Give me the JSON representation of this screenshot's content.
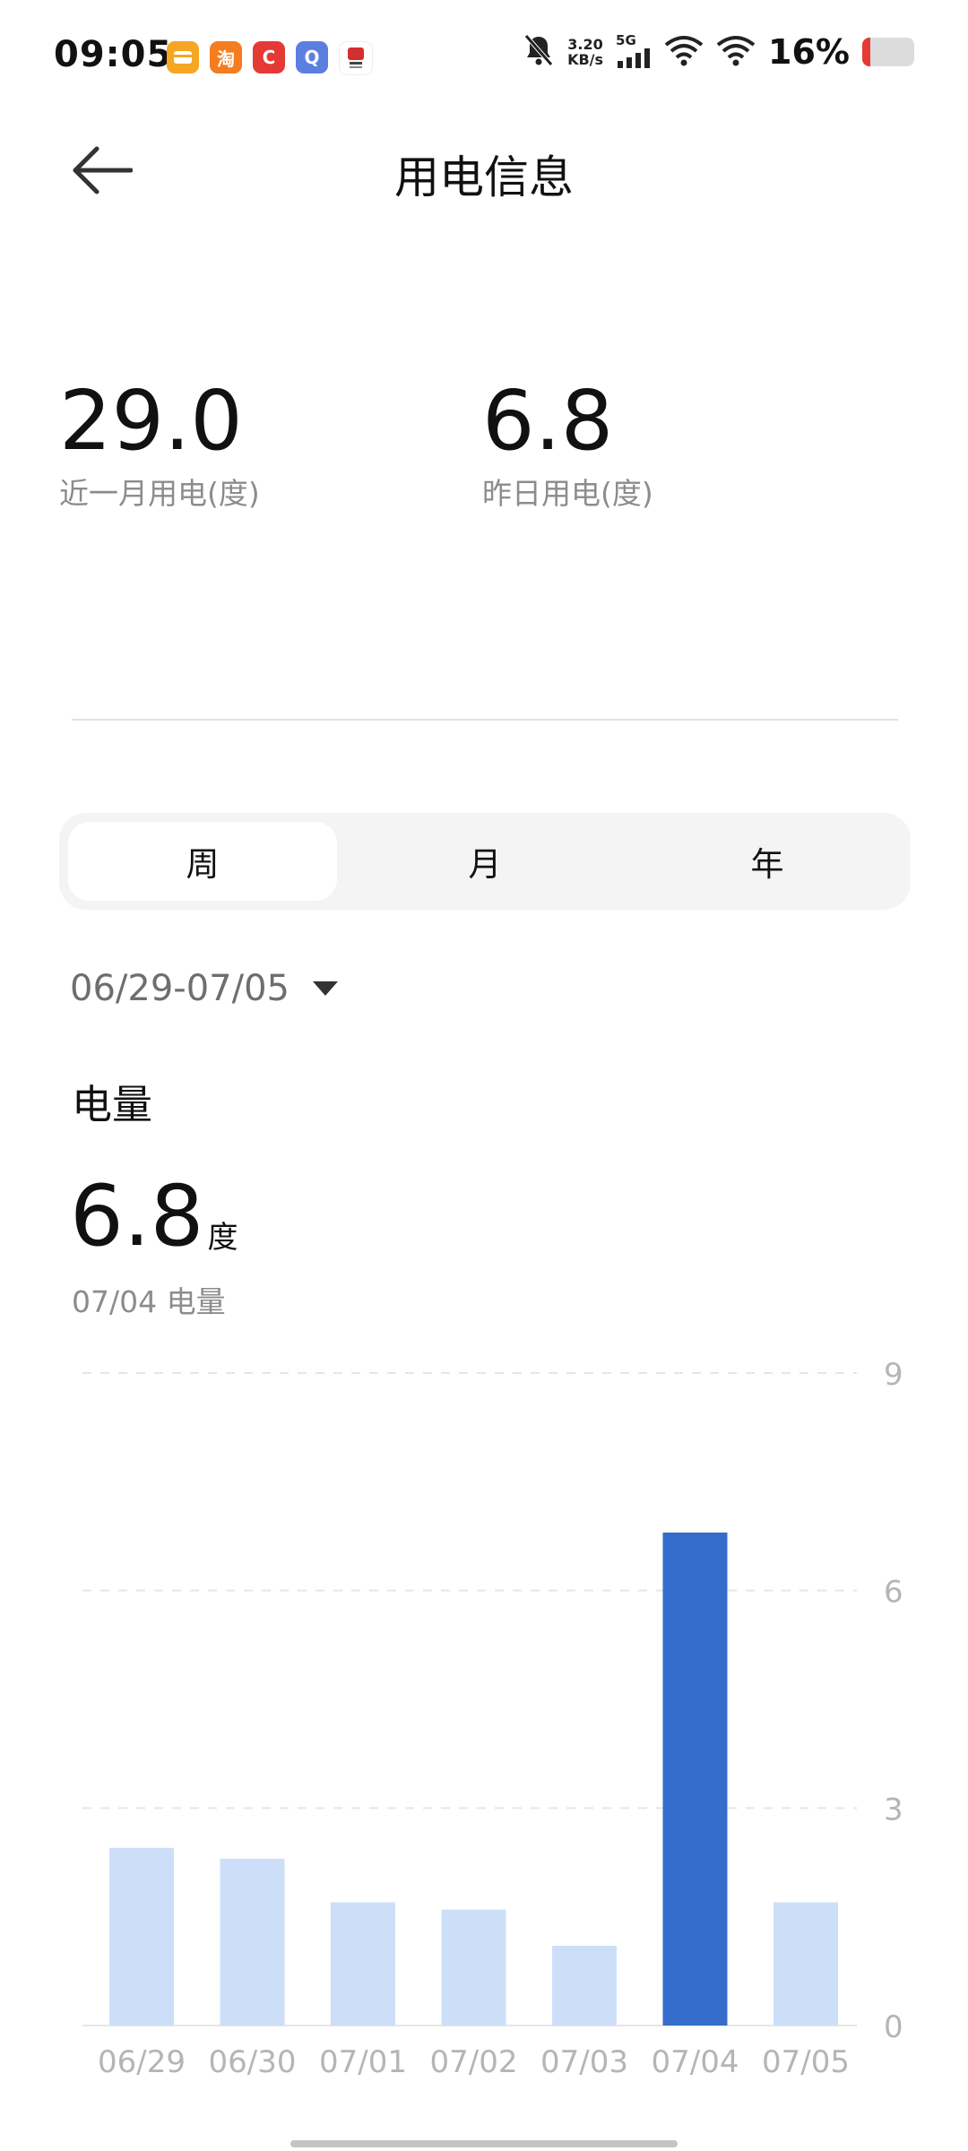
{
  "status_bar": {
    "time": "09:05",
    "net_speed_value": "3.20",
    "net_speed_unit": "KB/s",
    "signal_type": "5G",
    "battery_percent": "16%",
    "battery_level": 0.16,
    "app_icons": [
      "wallet-app-icon",
      "taobao-app-icon",
      "c-app-icon",
      "q-app-icon",
      "kfc-app-icon"
    ],
    "app_icon_text": {
      "taobao": "淘",
      "c": "C",
      "q": "Q"
    }
  },
  "header": {
    "title": "用电信息"
  },
  "summary": {
    "month_value": "29.0",
    "month_label": "近一月用电(度)",
    "yesterday_value": "6.8",
    "yesterday_label": "昨日用电(度)"
  },
  "tabs": [
    {
      "label": "周",
      "active": true
    },
    {
      "label": "月",
      "active": false
    },
    {
      "label": "年",
      "active": false
    }
  ],
  "date_range": "06/29-07/05",
  "section": {
    "title": "电量",
    "value": "6.8",
    "unit": "度",
    "caption": "07/04 电量"
  },
  "colors": {
    "bar_default": "#cddff8",
    "bar_selected": "#356bcb",
    "grid": "#e6e6e6",
    "axis_text": "#b5b5b5"
  },
  "chart_data": {
    "type": "bar",
    "categories": [
      "06/29",
      "06/30",
      "07/01",
      "07/02",
      "07/03",
      "07/04",
      "07/05"
    ],
    "values": [
      2.45,
      2.3,
      1.7,
      1.6,
      1.1,
      6.8,
      1.7
    ],
    "selected_index": 5,
    "ylim": [
      0,
      9
    ],
    "y_ticks": [
      "0",
      "3",
      "6",
      "9"
    ],
    "y_axis_position": "right",
    "grid": true,
    "title": "",
    "xlabel": "",
    "ylabel": ""
  }
}
